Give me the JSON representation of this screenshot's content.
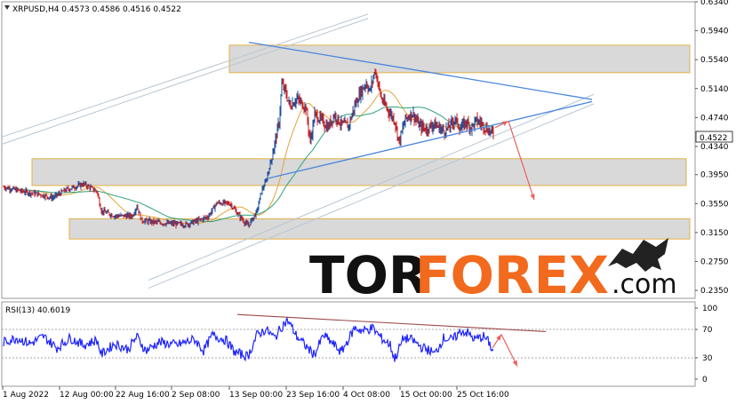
{
  "colors": {
    "bull": "#1f4e9a",
    "bear": "#cc1f1f",
    "ma_fast": "#e1a53c",
    "ma_slow": "#2fa37a",
    "zone_fill": "#d9d9d9",
    "zone_border": "#e3b048",
    "trend_line": "#4a86dd",
    "channel_line": "#b8c6d3",
    "arrow": "#e8615f",
    "rsi_line": "#1f24ff",
    "rsi_trend": "#9c4a4a",
    "price_tag_bg": "#ffffff"
  },
  "chart_data": [
    {
      "type": "candlestick",
      "title": "XRPUSD,H4  0.4573 0.4586 0.4516 0.4522",
      "current_price": "0.4522",
      "ylim": [
        0.224,
        0.634
      ],
      "yticks": [
        "0.6340",
        "0.5940",
        "0.5540",
        "0.5140",
        "0.4740",
        "0.4340",
        "0.3950",
        "0.3550",
        "0.3150",
        "0.2750",
        "0.2350"
      ],
      "xticks": [
        "1 Aug 2022",
        "12 Aug 00:00",
        "22 Aug 16:00",
        "2 Sep 08:00",
        "13 Sep 00:00",
        "23 Sep 16:00",
        "4 Oct 08:00",
        "15 Oct 00:00",
        "25 Oct 16:00"
      ],
      "candle_count": 360,
      "close_anchors": [
        [
          0,
          0.378
        ],
        [
          20,
          0.372
        ],
        [
          40,
          0.368
        ],
        [
          55,
          0.363
        ],
        [
          70,
          0.374
        ],
        [
          90,
          0.382
        ],
        [
          105,
          0.372
        ],
        [
          110,
          0.345
        ],
        [
          125,
          0.338
        ],
        [
          145,
          0.338
        ],
        [
          150,
          0.352
        ],
        [
          155,
          0.332
        ],
        [
          165,
          0.33
        ],
        [
          180,
          0.328
        ],
        [
          205,
          0.326
        ],
        [
          220,
          0.332
        ],
        [
          230,
          0.337
        ],
        [
          240,
          0.356
        ],
        [
          255,
          0.355
        ],
        [
          265,
          0.338
        ],
        [
          275,
          0.324
        ],
        [
          285,
          0.344
        ],
        [
          290,
          0.372
        ],
        [
          295,
          0.385
        ],
        [
          300,
          0.41
        ],
        [
          305,
          0.438
        ],
        [
          310,
          0.468
        ],
        [
          313,
          0.52
        ],
        [
          317,
          0.51
        ],
        [
          322,
          0.49
        ],
        [
          330,
          0.5
        ],
        [
          340,
          0.488
        ],
        [
          345,
          0.44
        ],
        [
          350,
          0.478
        ],
        [
          358,
          0.47
        ],
        [
          365,
          0.46
        ],
        [
          372,
          0.478
        ],
        [
          380,
          0.465
        ],
        [
          388,
          0.462
        ],
        [
          395,
          0.49
        ],
        [
          400,
          0.505
        ],
        [
          408,
          0.522
        ],
        [
          412,
          0.51
        ],
        [
          418,
          0.54
        ],
        [
          425,
          0.5
        ],
        [
          432,
          0.485
        ],
        [
          440,
          0.47
        ],
        [
          445,
          0.44
        ],
        [
          452,
          0.472
        ],
        [
          460,
          0.48
        ],
        [
          468,
          0.462
        ],
        [
          476,
          0.458
        ],
        [
          484,
          0.465
        ],
        [
          490,
          0.46
        ],
        [
          496,
          0.455
        ],
        [
          502,
          0.462
        ],
        [
          508,
          0.472
        ],
        [
          514,
          0.458
        ],
        [
          520,
          0.468
        ],
        [
          526,
          0.46
        ],
        [
          532,
          0.47
        ],
        [
          538,
          0.465
        ],
        [
          544,
          0.458
        ],
        [
          550,
          0.452
        ]
      ],
      "moving_averages": [
        "fast (orange)",
        "slow (green)"
      ],
      "zones": [
        {
          "from": 0.536,
          "to": 0.574
        },
        {
          "from": 0.38,
          "to": 0.417
        },
        {
          "from": 0.306,
          "to": 0.334
        }
      ],
      "trendlines": [
        {
          "kind": "resistance",
          "points": [
            [
              278,
              0.578
            ],
            [
              664,
              0.499
            ]
          ]
        },
        {
          "kind": "support",
          "points": [
            [
              300,
              0.39
            ],
            [
              664,
              0.496
            ]
          ]
        },
        {
          "kind": "channel",
          "points": [
            [
              0,
              0.447
            ],
            [
              412,
              0.617
            ]
          ]
        },
        {
          "kind": "channel",
          "points": [
            [
              0,
              0.437
            ],
            [
              412,
              0.611
            ]
          ]
        },
        {
          "kind": "channel",
          "points": [
            [
              165,
              0.249
            ],
            [
              666,
              0.506
            ]
          ]
        },
        {
          "kind": "channel",
          "points": [
            [
              165,
              0.238
            ],
            [
              666,
              0.493
            ]
          ]
        }
      ],
      "forecast_arrows": [
        {
          "points": [
            [
              555,
              0.46
            ],
            [
              570,
              0.469
            ]
          ]
        },
        {
          "points": [
            [
              570,
              0.469
            ],
            [
              599,
              0.36
            ]
          ]
        }
      ],
      "watermark": "TORFOREX.com"
    },
    {
      "type": "line",
      "title": "RSI(13) 40.6019",
      "ylim": [
        0,
        100
      ],
      "yticks": [
        "100",
        "70",
        "30",
        "0"
      ],
      "levels": [
        70,
        30
      ],
      "trendline": {
        "points": [
          [
            265,
            91
          ],
          [
            612,
            67
          ]
        ]
      },
      "forecast_arrows": [
        {
          "points": [
            [
              552,
              44
            ],
            [
              562,
              63
            ]
          ]
        },
        {
          "points": [
            [
              562,
              63
            ],
            [
              580,
              18
            ]
          ]
        }
      ],
      "rsi_anchors": [
        [
          0,
          52
        ],
        [
          15,
          58
        ],
        [
          30,
          50
        ],
        [
          45,
          60
        ],
        [
          60,
          44
        ],
        [
          75,
          58
        ],
        [
          90,
          48
        ],
        [
          105,
          55
        ],
        [
          110,
          35
        ],
        [
          125,
          50
        ],
        [
          140,
          42
        ],
        [
          150,
          60
        ],
        [
          160,
          40
        ],
        [
          175,
          52
        ],
        [
          195,
          48
        ],
        [
          215,
          56
        ],
        [
          225,
          40
        ],
        [
          235,
          62
        ],
        [
          250,
          55
        ],
        [
          260,
          38
        ],
        [
          275,
          32
        ],
        [
          285,
          62
        ],
        [
          295,
          70
        ],
        [
          305,
          58
        ],
        [
          315,
          78
        ],
        [
          320,
          82
        ],
        [
          330,
          60
        ],
        [
          345,
          40
        ],
        [
          350,
          35
        ],
        [
          360,
          62
        ],
        [
          372,
          48
        ],
        [
          380,
          38
        ],
        [
          395,
          72
        ],
        [
          405,
          68
        ],
        [
          415,
          72
        ],
        [
          425,
          58
        ],
        [
          435,
          48
        ],
        [
          440,
          28
        ],
        [
          450,
          58
        ],
        [
          460,
          55
        ],
        [
          470,
          45
        ],
        [
          480,
          40
        ],
        [
          485,
          35
        ],
        [
          495,
          58
        ],
        [
          505,
          55
        ],
        [
          515,
          68
        ],
        [
          522,
          65
        ],
        [
          530,
          56
        ],
        [
          540,
          60
        ],
        [
          546,
          52
        ],
        [
          550,
          40
        ]
      ]
    }
  ]
}
